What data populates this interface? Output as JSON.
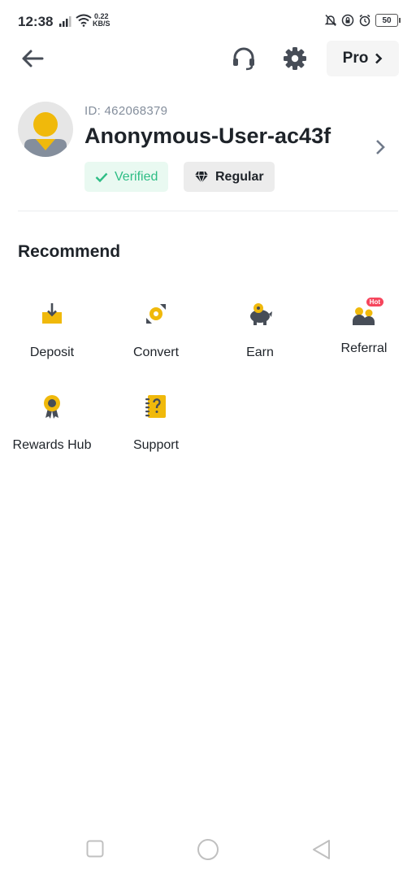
{
  "status_bar": {
    "time": "12:38",
    "net_speed_value": "0.22",
    "net_speed_unit": "KB/S",
    "battery": "50"
  },
  "header": {
    "pro_label": "Pro"
  },
  "profile": {
    "id": "ID: 462068379",
    "username": "Anonymous-User-ac43f",
    "verified_label": "Verified",
    "tier_label": "Regular"
  },
  "recommend": {
    "title": "Recommend",
    "items": [
      {
        "label": "Deposit"
      },
      {
        "label": "Convert"
      },
      {
        "label": "Earn"
      },
      {
        "label": "Referral",
        "badge": "Hot"
      },
      {
        "label": "Rewards Hub"
      },
      {
        "label": "Support"
      }
    ]
  },
  "colors": {
    "accent": "#F0B90B",
    "success": "#2EBD85",
    "hot": "#F6465D"
  }
}
